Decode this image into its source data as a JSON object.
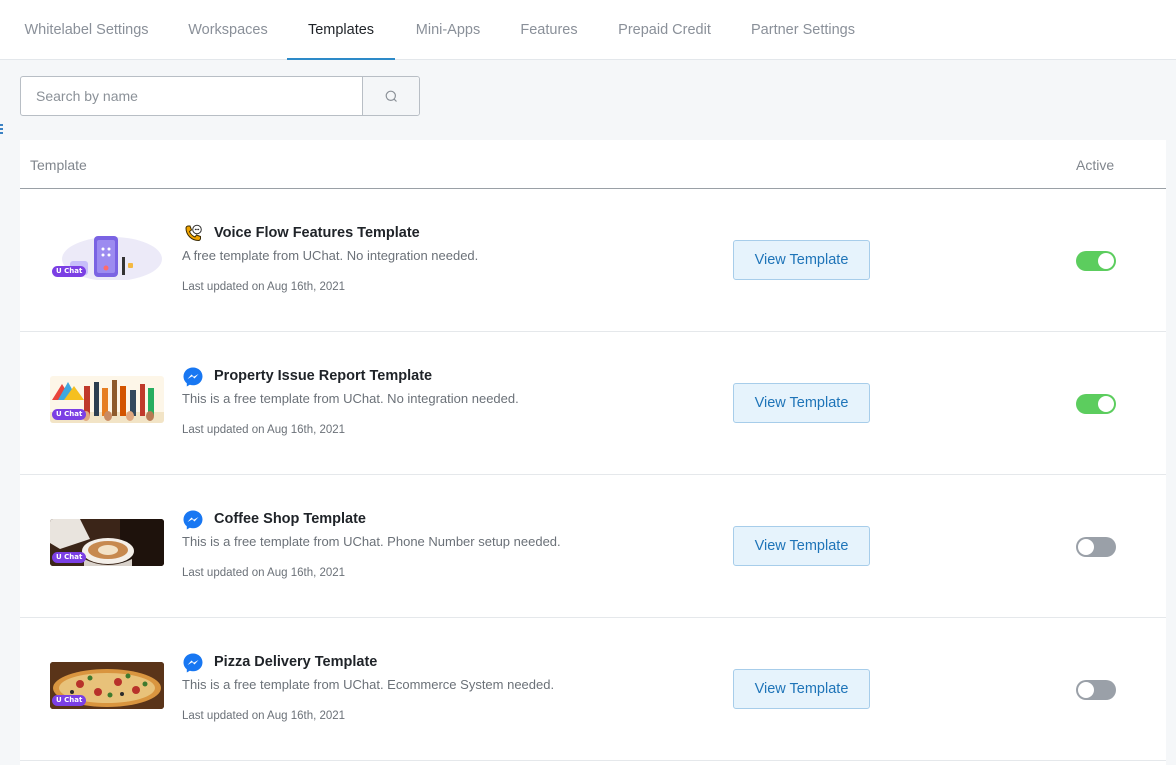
{
  "tabs": [
    {
      "label": "Whitelabel Settings",
      "active": false
    },
    {
      "label": "Workspaces",
      "active": false
    },
    {
      "label": "Templates",
      "active": true
    },
    {
      "label": "Mini-Apps",
      "active": false
    },
    {
      "label": "Features",
      "active": false
    },
    {
      "label": "Prepaid Credit",
      "active": false
    },
    {
      "label": "Partner Settings",
      "active": false
    }
  ],
  "search": {
    "placeholder": "Search by name",
    "value": "",
    "icon": "search-icon"
  },
  "table": {
    "columns": {
      "template": "Template",
      "active": "Active"
    },
    "rows": [
      {
        "title": "Voice Flow Features Template",
        "description": "A free template from UChat. No integration needed.",
        "updated": "Last updated on Aug 16th, 2021",
        "icon": "phone-chat-icon",
        "thumbnail": "voice-flow-thumbnail",
        "badge": "U Chat",
        "button": "View Template",
        "active": true
      },
      {
        "title": "Property Issue Report Template",
        "description": "This is a free template from UChat. No integration needed.",
        "updated": "Last updated on Aug 16th, 2021",
        "icon": "messenger-icon",
        "thumbnail": "property-tools-thumbnail",
        "badge": "U Chat",
        "button": "View Template",
        "active": true
      },
      {
        "title": "Coffee Shop Template",
        "description": "This is a free template from UChat. Phone Number setup needed.",
        "updated": "Last updated on Aug 16th, 2021",
        "icon": "messenger-icon",
        "thumbnail": "coffee-thumbnail",
        "badge": "U Chat",
        "button": "View Template",
        "active": false
      },
      {
        "title": "Pizza Delivery Template",
        "description": "This is a free template from UChat. Ecommerce System needed.",
        "updated": "Last updated on Aug 16th, 2021",
        "icon": "messenger-icon",
        "thumbnail": "pizza-thumbnail",
        "badge": "U Chat",
        "button": "View Template",
        "active": false
      }
    ]
  },
  "colors": {
    "accent": "#2d8ac8",
    "button_bg": "#e6f3fc",
    "button_text": "#1e74b8",
    "toggle_on": "#5ccd5e",
    "toggle_off": "#9aa0a8",
    "badge": "#7b3fe4",
    "messenger": "#1877f2"
  }
}
